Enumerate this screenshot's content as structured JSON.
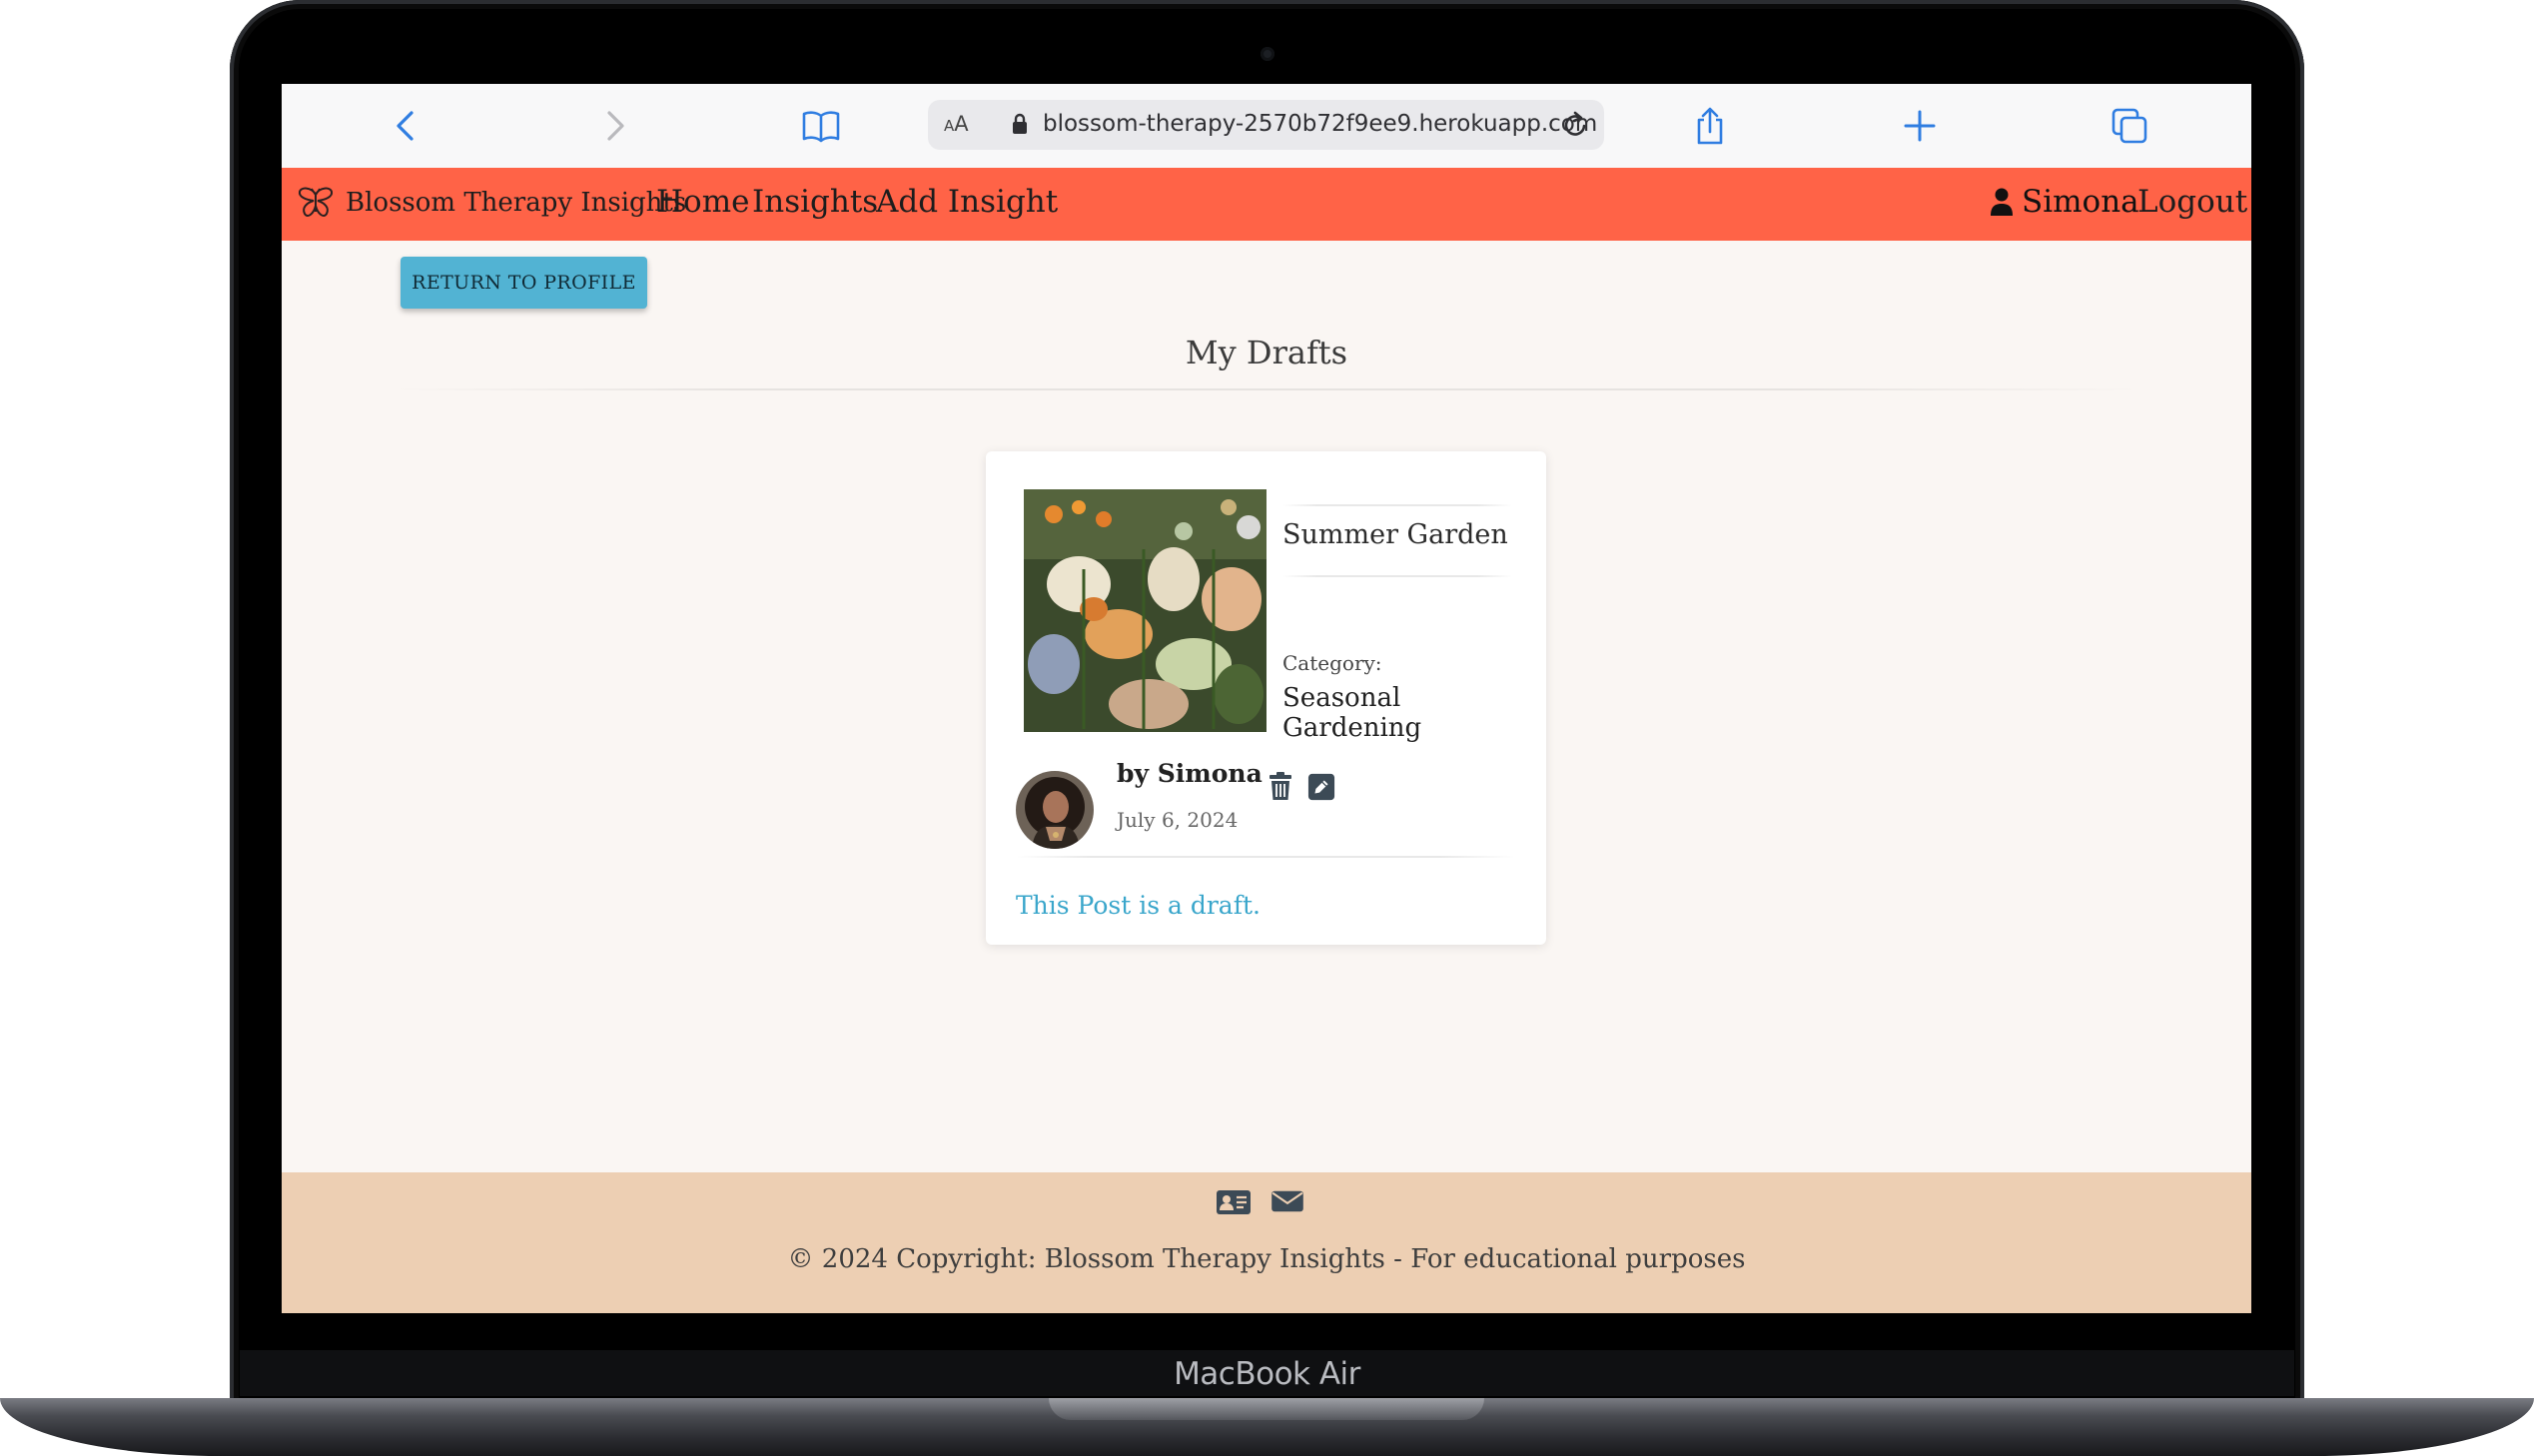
{
  "device": {
    "model_label": "MacBook Air"
  },
  "browser": {
    "text_size_label": "AA",
    "url": "blossom-therapy-2570b72f9ee9.herokuapp.com",
    "icons": [
      "back-icon",
      "forward-icon",
      "bookmarks-icon",
      "lock-icon",
      "reload-icon",
      "share-icon",
      "new-tab-icon",
      "tabs-icon"
    ]
  },
  "navbar": {
    "brand": "Blossom Therapy Insights",
    "links": {
      "home": "Home",
      "insights": "Insights",
      "add_insight": "Add Insight"
    },
    "user": "Simona",
    "logout": "Logout",
    "background": "#ff6347"
  },
  "main": {
    "return_button": "RETURN TO PROFILE",
    "page_title": "My Drafts",
    "post": {
      "title": "Summer Garden",
      "category_label": "Category:",
      "category": "Seasonal Gardening",
      "author": "by Simona",
      "date": "July 6, 2024",
      "draft_note": "This Post is a draft."
    }
  },
  "footer": {
    "icons": [
      "contact-card-icon",
      "envelope-icon"
    ],
    "copyright": "© 2024 Copyright: Blossom Therapy Insights - For educational purposes",
    "background": "#edcfb3"
  }
}
